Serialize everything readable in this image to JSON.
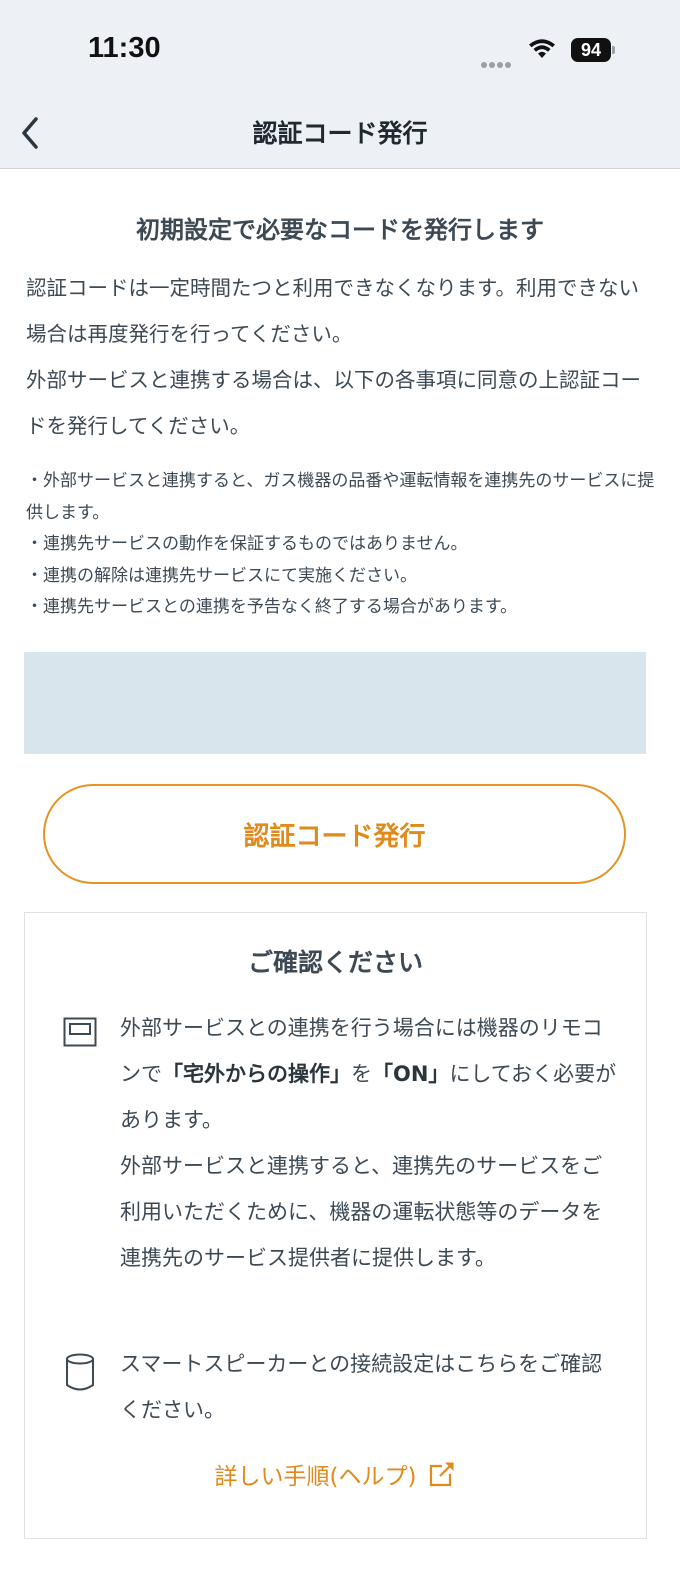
{
  "status_bar": {
    "time": "11:30",
    "battery": "94"
  },
  "nav": {
    "title": "認証コード発行"
  },
  "main": {
    "heading": "初期設定で必要なコードを発行します",
    "lead": [
      "認証コードは一定時間たつと利用できなくなります。利用できない場合は再度発行を行ってください。",
      "外部サービスと連携する場合は、以下の各事項に同意の上認証コードを発行してください。"
    ],
    "notes": [
      "・外部サービスと連携すると、ガス機器の品番や運転情報を連携先のサービスに提供します。",
      "・連携先サービスの動作を保証するものではありません。",
      "・連携の解除は連携先サービスにて実施ください。",
      "・連携先サービスとの連携を予告なく終了する場合があります。"
    ],
    "issue_button": "認証コード発行"
  },
  "confirm": {
    "title": "ご確認ください",
    "item1": {
      "part1": "外部サービスとの連携を行う場合には機器のリモコンで",
      "bold1": "「宅外からの操作」",
      "part2": "を",
      "bold2": "「ON」",
      "part3": "にしておく必要があります。",
      "part4": "外部サービスと連携すると、連携先のサービスをご利用いただくために、機器の運転状態等のデータを連携先のサービス提供者に提供します。"
    },
    "item2": {
      "text": "スマートスピーカーとの接続設定はこちらをご確認ください。"
    },
    "help_link": "詳しい手順(ヘルプ)"
  },
  "colors": {
    "accent": "#e59322",
    "text": "#3d4a55",
    "band": "#d9e5ec",
    "bar": "#edf0f4"
  }
}
